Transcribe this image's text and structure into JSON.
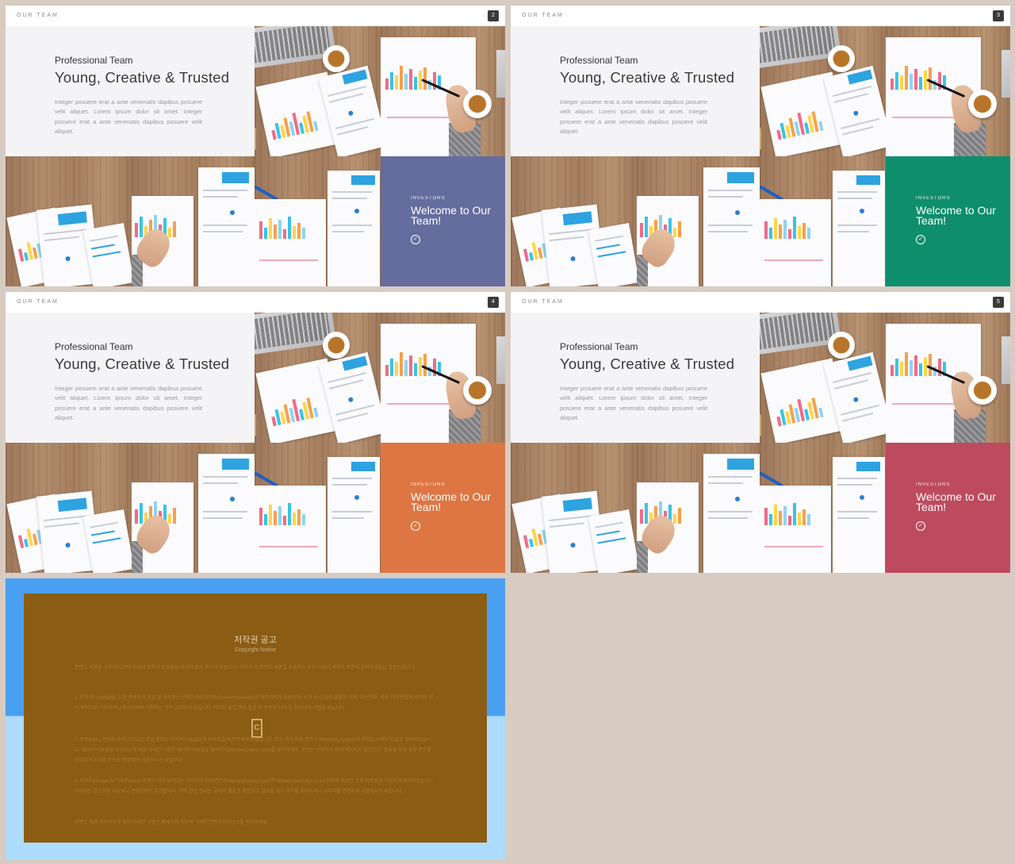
{
  "slides": [
    {
      "page": "2",
      "section_label": "OUR TEAM",
      "subtitle": "Professional Team",
      "title": "Young, Creative & Trusted",
      "description": "Integer posuere erat a ante venenatis dapibus posuere velit aliquet. Lorem ipsum dolor sit amet. Integer posuere erat a ante venenatis dapibus posuere velit aliquet.",
      "panel": {
        "tag": "INVESTORS",
        "title": "Welcome to Our Team!",
        "color": "#656c9e"
      }
    },
    {
      "page": "3",
      "section_label": "OUR TEAM",
      "subtitle": "Professional Team",
      "title": "Young, Creative & Trusted",
      "description": "Integer posuere erat a ante venenatis dapibus posuere velit aliquet. Lorem ipsum dolor sit amet. Integer posuere erat a ante venenatis dapibus posuere velit aliquet.",
      "panel": {
        "tag": "INVESTORS",
        "title": "Welcome to Our Team!",
        "color": "#0e8e6d"
      }
    },
    {
      "page": "4",
      "section_label": "OUR TEAM",
      "subtitle": "Professional Team",
      "title": "Young, Creative & Trusted",
      "description": "Integer posuere erat a ante venenatis dapibus posuere velit aliquet. Lorem ipsum dolor sit amet. Integer posuere erat a ante venenatis dapibus posuere velit aliquet.",
      "panel": {
        "tag": "INVESTORS",
        "title": "Welcome to Our Team!",
        "color": "#dd7643"
      }
    },
    {
      "page": "5",
      "section_label": "OUR TEAM",
      "subtitle": "Professional Team",
      "title": "Young, Creative & Trusted",
      "description": "Integer posuere erat a ante venenatis dapibus posuere velit aliquet. Lorem ipsum dolor sit amet. Integer posuere erat a ante venenatis dapibus posuere velit aliquet.",
      "panel": {
        "tag": "INVESTORS",
        "title": "Welcome to Our Team!",
        "color": "#bd4a5e"
      }
    }
  ],
  "notice": {
    "title": "저작권 공고",
    "subtitle": "Copyright Notice",
    "paragraphs": [
      "콘텐츠 제품을 사용하기 전에 다음의 항목과 조항들을 자세히 읽어 주시기 바랍니다. 귀하가 이 콘텐츠 제품을 사용하는 것은 사용자 계약과 보증에 동의하셨음을 말씀드립니다.",
      "1. 저작권(copyright): 모든 콘텐츠의 소유 및 저작권은 콘텐츠테이크아웃(Contentstakeout)과 제작자에게 있습니다. 사전 승낙 없이 불법적 이용, 무단전재, 배포 기타 방법에 의하여 영리 목적으로 이용하거나 제삼자에게 이용하는 것은 금지되어 있습니다. 이러한 불법 행위 발견 시 관련한 민사 및 형사상의 처벌을 받습니다.",
      "2. 폰트(font): 콘텐츠 내에 담겨있는 한글 폰트는 네이버 나눔글꼴의 저작권을 따르며 제작되었습니다. 한글 외의 모든 폰트는 Windows System에 포함된 서체의 글꼴로 제작되었습니다. 네이버 나눔글꼴 라이선스에 대한 자세한 사항은 네이버 나눔글꼴 홈페이지(hangeul.naver.com)를 참조하세요. 폰트는 콘텐츠와 함께 제공되지 않으므로, 필요할 경우 정품 폰트를 구입하거나 다른 폰트로 변경하여 사용하시기 바랍니다.",
      "3. 이미지(image) & 아이콘(icon): 콘텐츠 내에 담겨있는 이미지와 아이콘은 Pixabay(pixabay.com)와 Webalys(webalys.com) 등에서 제공한 무료 저작물을 이용하여 제작되었습니다. 이미지는 참고로만 제공되고 콘텐츠와는 무관합니다. 이에 관한 권리는 귀하가 별도로 확인하고 필요할 경우 허가를 취득하거나 이미지를 변경하여 사용하시기 바랍니다.",
      "콘텐츠 제품 라이선스에 대한 자세한 사항은 홈페이지 하단에 기재한 콘텐츠라이선스를 참조하세요."
    ]
  }
}
